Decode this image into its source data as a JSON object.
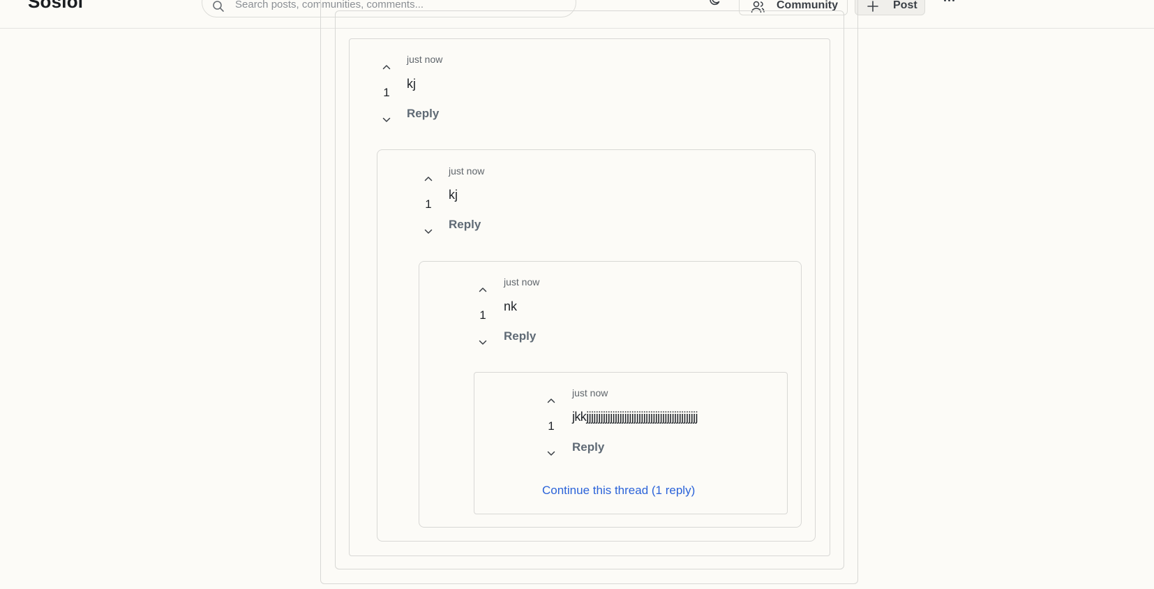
{
  "header": {
    "logo": "Sosioi",
    "search_placeholder": "Search posts, communities, comments...",
    "community_label": "Community",
    "post_label": "Post"
  },
  "icons": {
    "search": "search-icon",
    "theme": "moon-icon",
    "community": "user-icon",
    "post": "plus-icon",
    "more": "more-icon",
    "upvote": "chevron-up-icon",
    "downvote": "chevron-down-icon"
  },
  "comments": [
    {
      "time": "just now",
      "text": "kj",
      "score": "1",
      "reply_label": "Reply"
    },
    {
      "time": "just now",
      "text": "kj",
      "score": "1",
      "reply_label": "Reply"
    },
    {
      "time": "just now",
      "text": "nk",
      "score": "1",
      "reply_label": "Reply"
    },
    {
      "time": "just now",
      "text": "jkkjjjjjjjjjjjjjjjjjjjjjjjjjjjjjjjjjjjjjjjjjjjjjjj",
      "score": "1",
      "reply_label": "Reply"
    }
  ],
  "continue_thread": "Continue this thread (1 reply)",
  "colors": {
    "background": "#fcfbf7",
    "border": "#d8d8d5",
    "link": "#2b63d9",
    "muted": "#5f656b"
  }
}
